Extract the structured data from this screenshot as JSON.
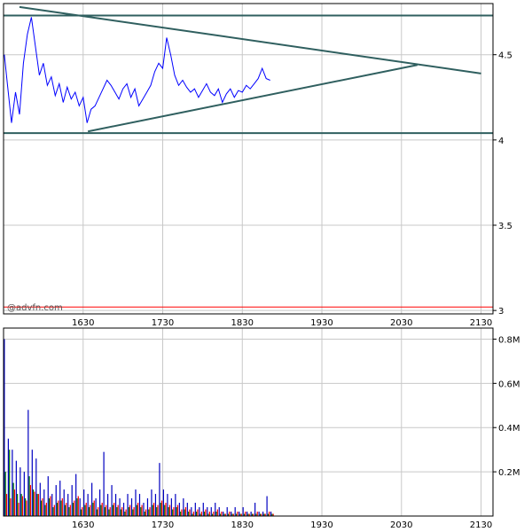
{
  "watermark": "@advfn.com",
  "colors": {
    "price": "#0000ff",
    "trendline": "#2f5f5f",
    "support_red": "#ff0000",
    "grid": "#c8c8c8",
    "vol_red": "#ff0000",
    "vol_blue": "#0000c0",
    "vol_green": "#007700",
    "frame": "#000000"
  },
  "chart_data": [
    {
      "type": "line",
      "title": "",
      "xlabel": "",
      "ylabel": "",
      "x_ticks": [
        "1630",
        "1730",
        "1830",
        "1930",
        "2030",
        "2130"
      ],
      "y_ticks": [
        "3",
        "3.5",
        "4",
        "4.5"
      ],
      "ylim": [
        2.98,
        4.8
      ],
      "xlim": [
        1530,
        2130
      ],
      "grid": true,
      "series": [
        {
          "role": "price",
          "x": [
            1531,
            1535,
            1540,
            1545,
            1550,
            1555,
            1560,
            1565,
            1570,
            1575,
            1580,
            1585,
            1590,
            1595,
            1600,
            1605,
            1610,
            1615,
            1620,
            1625,
            1630,
            1635,
            1640,
            1645,
            1650,
            1655,
            1660,
            1665,
            1670,
            1675,
            1680,
            1685,
            1690,
            1695,
            1700,
            1705,
            1710,
            1715,
            1720,
            1725,
            1730,
            1735,
            1740,
            1745,
            1750,
            1755,
            1760,
            1765,
            1770,
            1775,
            1780,
            1785,
            1790,
            1795,
            1800,
            1805,
            1810,
            1815,
            1820,
            1825,
            1830,
            1835,
            1840,
            1845,
            1850,
            1855,
            1860,
            1865
          ],
          "y": [
            4.5,
            4.32,
            4.1,
            4.28,
            4.15,
            4.45,
            4.62,
            4.72,
            4.55,
            4.38,
            4.45,
            4.32,
            4.37,
            4.26,
            4.33,
            4.22,
            4.31,
            4.24,
            4.28,
            4.2,
            4.25,
            4.1,
            4.18,
            4.2,
            4.25,
            4.3,
            4.35,
            4.32,
            4.28,
            4.24,
            4.3,
            4.33,
            4.25,
            4.3,
            4.2,
            4.24,
            4.28,
            4.32,
            4.4,
            4.45,
            4.42,
            4.6,
            4.5,
            4.38,
            4.32,
            4.35,
            4.31,
            4.28,
            4.3,
            4.25,
            4.29,
            4.33,
            4.28,
            4.26,
            4.3,
            4.22,
            4.27,
            4.3,
            4.25,
            4.29,
            4.28,
            4.32,
            4.3,
            4.33,
            4.36,
            4.42,
            4.36,
            4.35
          ]
        }
      ],
      "trendlines": [
        {
          "role": "resistance-diagonal",
          "x": [
            1550,
            2130
          ],
          "y": [
            4.78,
            4.39
          ]
        },
        {
          "role": "support-diagonal",
          "x": [
            1636,
            2050
          ],
          "y": [
            4.05,
            4.44
          ]
        },
        {
          "role": "horizontal-top",
          "x": [
            1530,
            2145
          ],
          "y": [
            4.73,
            4.73
          ]
        },
        {
          "role": "horizontal-support",
          "x": [
            1530,
            2145
          ],
          "y": [
            4.04,
            4.04
          ]
        },
        {
          "role": "horizontal-red",
          "x": [
            1530,
            2145
          ],
          "y": [
            3.02,
            3.02
          ]
        }
      ]
    },
    {
      "type": "bar",
      "title": "",
      "xlabel": "",
      "ylabel": "",
      "x_ticks": [
        "1630",
        "1730",
        "1830",
        "1930",
        "2030",
        "2130"
      ],
      "y_ticks": [
        "0.2M",
        "0.4M",
        "0.6M",
        "0.8M"
      ],
      "ylim": [
        0,
        0.85
      ],
      "xlim": [
        1530,
        2130
      ],
      "grid": true,
      "unit": "M",
      "x": [
        1531,
        1536,
        1541,
        1546,
        1551,
        1556,
        1561,
        1566,
        1571,
        1576,
        1581,
        1586,
        1591,
        1596,
        1601,
        1606,
        1611,
        1616,
        1621,
        1626,
        1631,
        1636,
        1641,
        1646,
        1651,
        1656,
        1661,
        1666,
        1671,
        1676,
        1681,
        1686,
        1691,
        1696,
        1701,
        1706,
        1711,
        1716,
        1721,
        1726,
        1731,
        1736,
        1741,
        1746,
        1751,
        1756,
        1761,
        1766,
        1771,
        1776,
        1781,
        1786,
        1791,
        1796,
        1801,
        1806,
        1811,
        1816,
        1821,
        1826,
        1831,
        1836,
        1841,
        1846,
        1851,
        1856,
        1861,
        1866
      ],
      "series": [
        {
          "color": "red",
          "values": [
            0.1,
            0.08,
            0.12,
            0.06,
            0.09,
            0.07,
            0.14,
            0.11,
            0.1,
            0.08,
            0.06,
            0.09,
            0.05,
            0.07,
            0.08,
            0.06,
            0.05,
            0.07,
            0.09,
            0.04,
            0.06,
            0.05,
            0.07,
            0.04,
            0.06,
            0.05,
            0.04,
            0.06,
            0.05,
            0.04,
            0.03,
            0.05,
            0.04,
            0.06,
            0.05,
            0.03,
            0.04,
            0.06,
            0.05,
            0.07,
            0.06,
            0.05,
            0.04,
            0.05,
            0.03,
            0.04,
            0.03,
            0.02,
            0.03,
            0.02,
            0.03,
            0.02,
            0.02,
            0.03,
            0.02,
            0.01,
            0.02,
            0.01,
            0.02,
            0.01,
            0.02,
            0.01,
            0.01,
            0.02,
            0.01,
            0.01,
            0.02,
            0.01
          ]
        },
        {
          "color": "blue",
          "values": [
            0.8,
            0.35,
            0.3,
            0.25,
            0.22,
            0.2,
            0.48,
            0.3,
            0.26,
            0.15,
            0.12,
            0.18,
            0.1,
            0.14,
            0.16,
            0.12,
            0.1,
            0.14,
            0.19,
            0.08,
            0.12,
            0.1,
            0.15,
            0.08,
            0.12,
            0.29,
            0.1,
            0.14,
            0.1,
            0.08,
            0.06,
            0.1,
            0.08,
            0.12,
            0.1,
            0.06,
            0.08,
            0.12,
            0.1,
            0.24,
            0.12,
            0.1,
            0.08,
            0.1,
            0.06,
            0.08,
            0.06,
            0.04,
            0.06,
            0.04,
            0.06,
            0.04,
            0.04,
            0.06,
            0.04,
            0.02,
            0.04,
            0.02,
            0.04,
            0.02,
            0.04,
            0.02,
            0.02,
            0.06,
            0.02,
            0.02,
            0.09,
            0.02
          ]
        },
        {
          "color": "green",
          "values": [
            0.2,
            0.3,
            0.15,
            0.1,
            0.1,
            0.08,
            0.18,
            0.12,
            0.1,
            0.07,
            0.05,
            0.08,
            0.04,
            0.06,
            0.07,
            0.05,
            0.04,
            0.06,
            0.08,
            0.03,
            0.05,
            0.04,
            0.06,
            0.03,
            0.05,
            0.04,
            0.03,
            0.05,
            0.04,
            0.03,
            0.02,
            0.04,
            0.03,
            0.05,
            0.04,
            0.02,
            0.03,
            0.05,
            0.04,
            0.06,
            0.05,
            0.04,
            0.03,
            0.04,
            0.02,
            0.03,
            0.02,
            0.01,
            0.02,
            0.01,
            0.02,
            0.01,
            0.01,
            0.02,
            0.01,
            0.01,
            0.01,
            0.01,
            0.01,
            0.01,
            0.01,
            0.01,
            0.01,
            0.01,
            0.01,
            0.01,
            0.01,
            0.01
          ]
        }
      ]
    }
  ]
}
